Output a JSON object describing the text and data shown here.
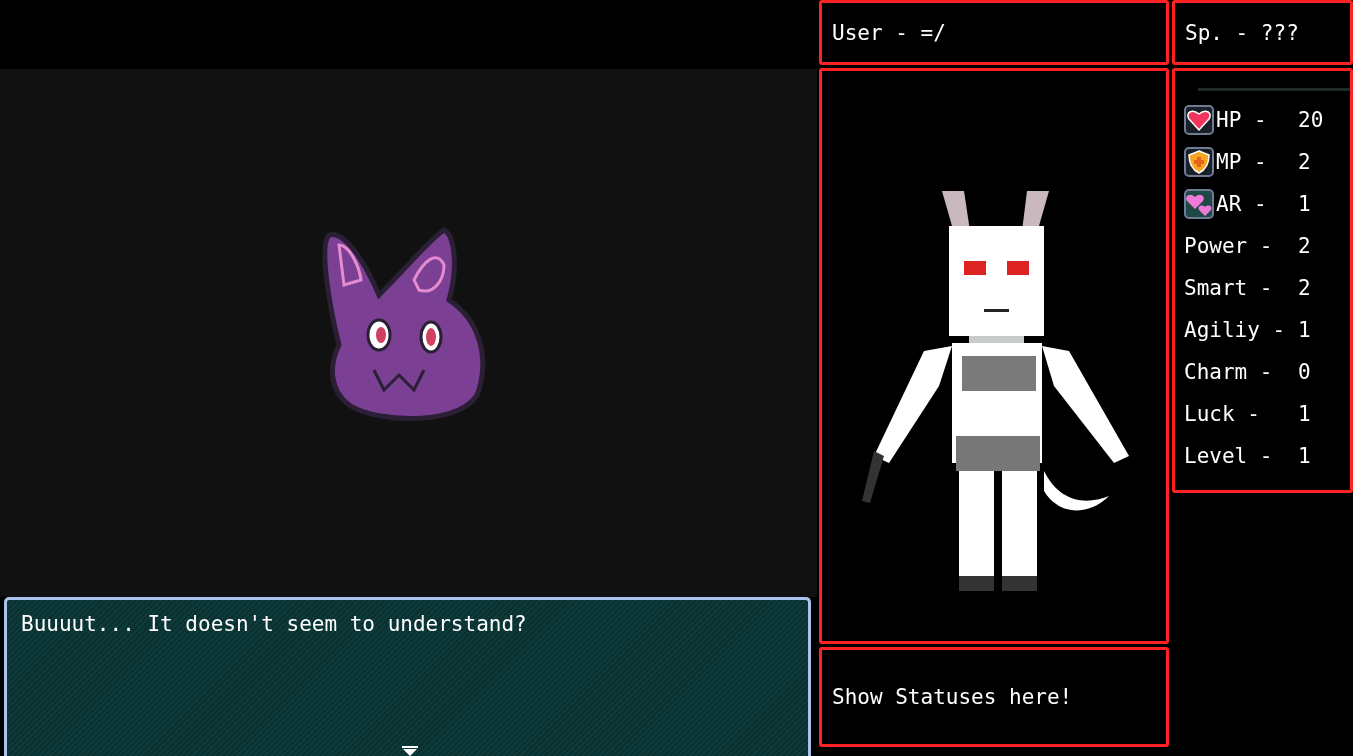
{
  "header": {
    "user": "User - =/",
    "species": "Sp. - ???"
  },
  "stats": [
    {
      "kind": "heart",
      "label": "HP -",
      "value": "20"
    },
    {
      "kind": "shield",
      "label": "MP -",
      "value": "2"
    },
    {
      "kind": "hearts",
      "label": "AR -",
      "value": "1"
    },
    {
      "kind": "plain",
      "label": "Power -",
      "value": "2"
    },
    {
      "kind": "plain",
      "label": "Smart -",
      "value": "2"
    },
    {
      "kind": "plain",
      "label": "Agiliy -",
      "value": "1"
    },
    {
      "kind": "plain",
      "label": "Charm -",
      "value": "0"
    },
    {
      "kind": "plain",
      "label": "Luck -",
      "value": "1"
    },
    {
      "kind": "plain",
      "label": "Level -",
      "value": "1"
    }
  ],
  "status_panel": {
    "text": "Show Statuses here!"
  },
  "dialog": {
    "message": "Buuuut... It doesn't seem to understand?"
  }
}
